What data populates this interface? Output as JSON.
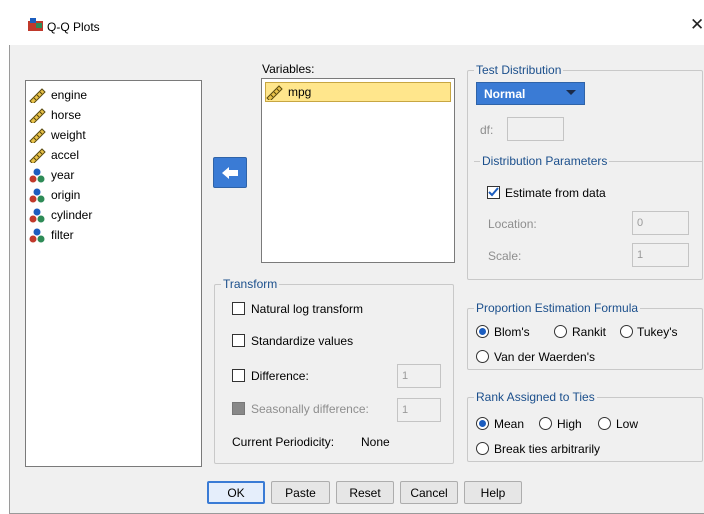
{
  "window": {
    "title": "Q-Q Plots",
    "close_glyph": "✕"
  },
  "source_variables": [
    {
      "name": "engine",
      "icon": "ruler-icon"
    },
    {
      "name": "horse",
      "icon": "ruler-icon"
    },
    {
      "name": "weight",
      "icon": "ruler-icon"
    },
    {
      "name": "accel",
      "icon": "ruler-icon"
    },
    {
      "name": "year",
      "icon": "nominal-balls-icon"
    },
    {
      "name": "origin",
      "icon": "nominal-balls-icon"
    },
    {
      "name": "cylinder",
      "icon": "nominal-balls-icon"
    },
    {
      "name": "filter",
      "icon": "nominal-balls-icon"
    }
  ],
  "variables": {
    "label": "Variables:",
    "items": [
      {
        "name": "mpg",
        "icon": "ruler-icon"
      }
    ]
  },
  "test_distribution": {
    "title": "Test Distribution",
    "selected": "Normal",
    "df_label": "df:",
    "df_value": ""
  },
  "distribution_parameters": {
    "title": "Distribution Parameters",
    "estimate_label": "Estimate from data",
    "estimate_checked": true,
    "location_label": "Location:",
    "location_value": "0",
    "scale_label": "Scale:",
    "scale_value": "1"
  },
  "transform": {
    "title": "Transform",
    "natural_log": "Natural log transform",
    "standardize": "Standardize values",
    "difference": "Difference:",
    "difference_value": "1",
    "seasonal": "Seasonally difference:",
    "seasonal_value": "1",
    "periodicity_label": "Current Periodicity:",
    "periodicity_value": "None"
  },
  "proportion": {
    "title": "Proportion Estimation Formula",
    "options": [
      "Blom's",
      "Rankit",
      "Tukey's",
      "Van der Waerden's"
    ],
    "selected": "Blom's"
  },
  "ties": {
    "title": "Rank Assigned to Ties",
    "options": [
      "Mean",
      "High",
      "Low",
      "Break ties arbitrarily"
    ],
    "selected": "Mean"
  },
  "buttons": {
    "ok": "OK",
    "paste": "Paste",
    "reset": "Reset",
    "cancel": "Cancel",
    "help": "Help"
  },
  "colors": {
    "accent": "#3a7bd5",
    "selection": "#ffe68c",
    "group_title": "#1b4f8c"
  }
}
